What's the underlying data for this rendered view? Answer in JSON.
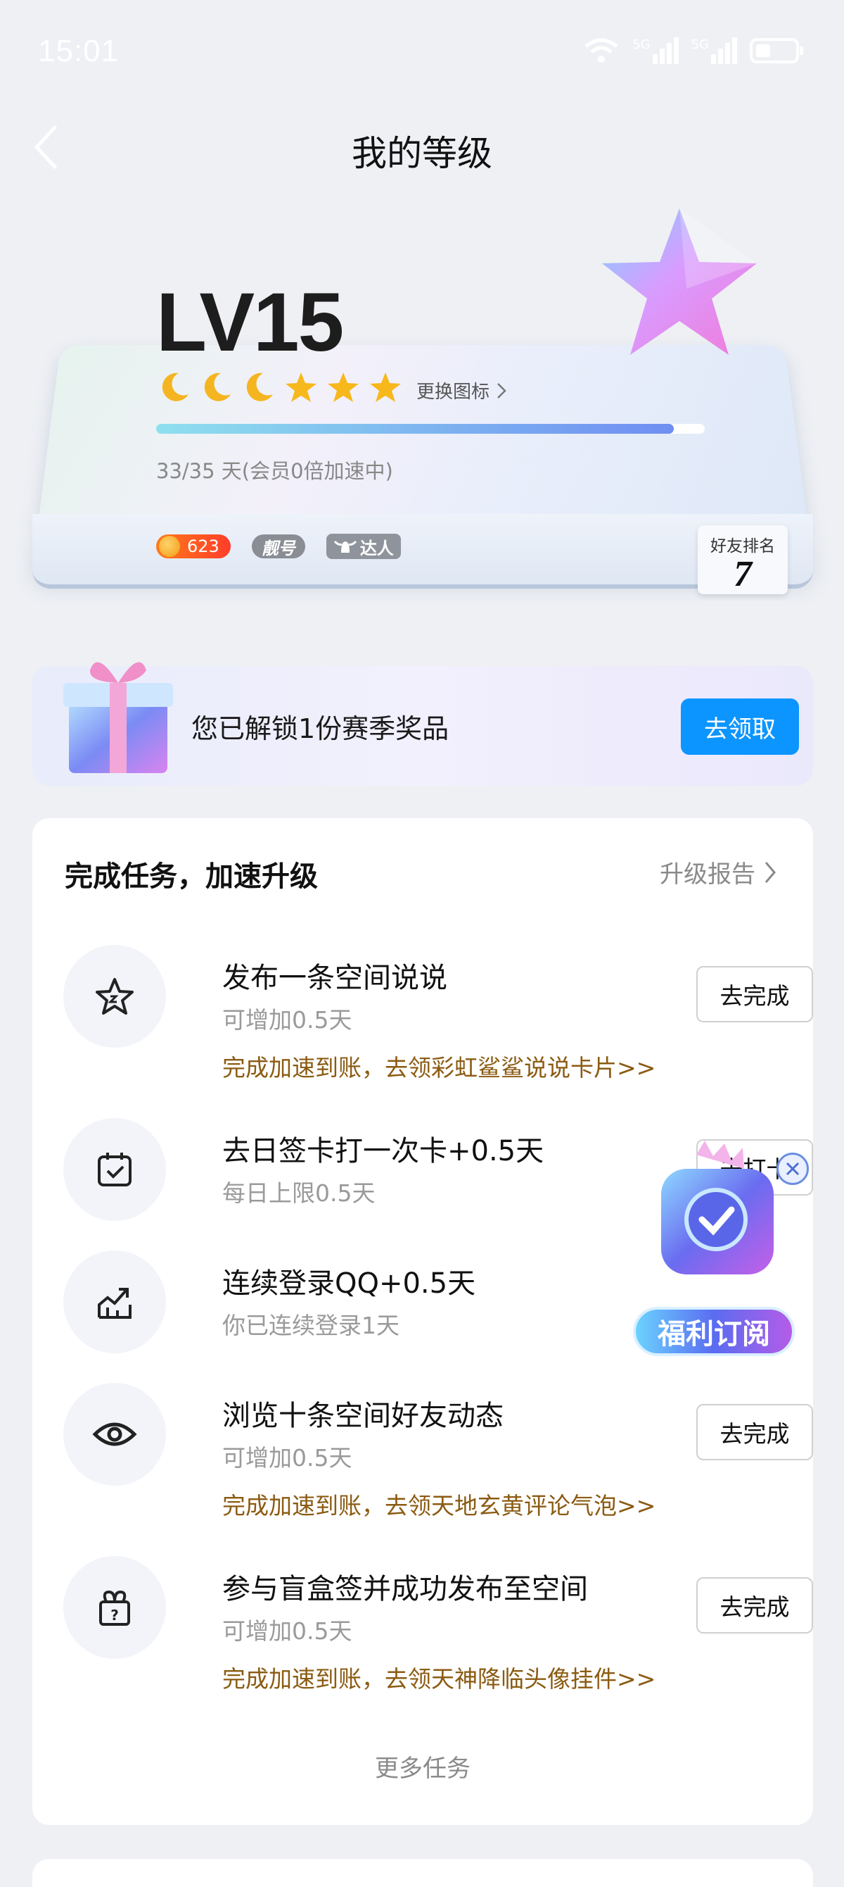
{
  "status_bar": {
    "time": "15:01",
    "net1": "5G",
    "net2": "5G"
  },
  "nav": {
    "title": "我的等级"
  },
  "level_card": {
    "level": "LV15",
    "change_icon": "更换图标",
    "progress_text": "33/35 天(会员0倍加速中)",
    "progress_fraction": 0.943,
    "coins": "623",
    "nice_id_badge": "靓号",
    "expert_badge": "达人",
    "rank_label": "好友排名",
    "rank_value": "7",
    "icons": [
      "moon-icon",
      "moon-icon",
      "moon-icon",
      "star-icon",
      "star-icon",
      "star-icon"
    ]
  },
  "gift_banner": {
    "text": "您已解锁1份赛季奖品",
    "button": "去领取"
  },
  "tasks": {
    "title": "完成任务，加速升级",
    "report_link": "升级报告",
    "items": [
      {
        "name": "发布一条空间说说",
        "sub": "可增加0.5天",
        "reward": "完成加速到账，去领彩虹鲨鲨说说卡片>>",
        "button": "去完成",
        "icon": "star-icon"
      },
      {
        "name": "去日签卡打一次卡+0.5天",
        "sub": "每日上限0.5天",
        "reward": "",
        "button": "去打卡",
        "icon": "calendar-check-icon"
      },
      {
        "name": "连续登录QQ+0.5天",
        "sub": "你已连续登录1天",
        "reward": "",
        "button": "",
        "icon": "trend-up-icon"
      },
      {
        "name": "浏览十条空间好友动态",
        "sub": "可增加0.5天",
        "reward": "完成加速到账，去领天地玄黄评论气泡>>",
        "button": "去完成",
        "icon": "eye-icon"
      },
      {
        "name": "参与盲盒签并成功发布至空间",
        "sub": "可增加0.5天",
        "reward": "完成加速到账，去领天神降临头像挂件>>",
        "button": "去完成",
        "icon": "mystery-box-icon"
      }
    ],
    "more": "更多任务"
  },
  "float_ad": {
    "label": "福利订阅"
  }
}
